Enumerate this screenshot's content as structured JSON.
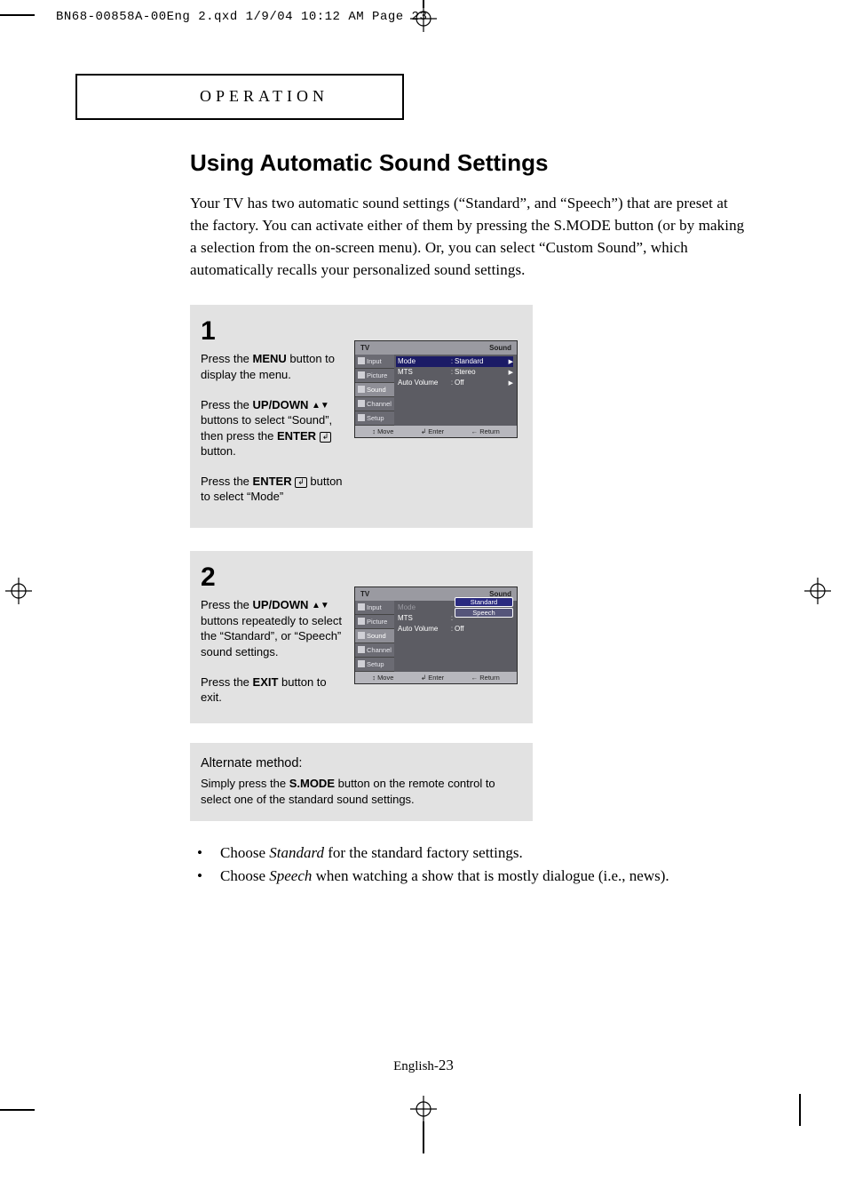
{
  "slug": "BN68-00858A-00Eng 2.qxd  1/9/04 10:12 AM  Page 23",
  "section_header": "OPERATION",
  "title": "Using Automatic Sound Settings",
  "intro": "Your TV has two automatic sound settings (“Standard”, and “Speech”) that are preset at the factory. You can activate either of them by pressing the S.MODE button (or by making a selection from the on-screen menu). Or, you can select “Custom Sound”, which automatically recalls your personalized sound settings.",
  "step1": {
    "num": "1",
    "p1a": "Press the ",
    "p1b": "MENU",
    "p1c": " button to display the menu.",
    "p2a": "Press the ",
    "p2b": "UP/DOWN",
    "p2c": " buttons to select “Sound”, then press the ",
    "p2d": "ENTER",
    "p2e": " button.",
    "p3a": "Press the ",
    "p3b": "ENTER",
    "p3c": " button to select “Mode”",
    "tri_up": "▲",
    "tri_down": "▼",
    "enter_glyph": "↲"
  },
  "step2": {
    "num": "2",
    "p1a": "Press the ",
    "p1b": "UP/DOWN",
    "p1c": " buttons repeatedly to select the “Standard”, or “Speech” sound settings.",
    "p2a": "Press the ",
    "p2b": "EXIT",
    "p2c": " button to exit.",
    "tri_up": "▲",
    "tri_down": "▼"
  },
  "alt": {
    "head": "Alternate method:",
    "body_a": "Simply press the ",
    "body_b": "S.MODE",
    "body_c": " button on the remote control to select one of the standard sound settings."
  },
  "bullets": [
    {
      "pre": "Choose ",
      "em": "Standard",
      "post": " for the standard factory settings."
    },
    {
      "pre": "Choose ",
      "em": "Speech",
      "post": " when watching a show that is mostly dialogue (i.e., news)."
    }
  ],
  "osd_labels": {
    "tv": "TV",
    "sound": "Sound",
    "tabs": [
      "Input",
      "Picture",
      "Sound",
      "Channel",
      "Setup"
    ],
    "mode": "Mode",
    "mts": "MTS",
    "auto_volume": "Auto Volume",
    "standard": "Standard",
    "stereo": "Stereo",
    "off": "Off",
    "speech": "Speech",
    "move": "Move",
    "enter": "Enter",
    "return": "Return",
    "colon": ":",
    "rarrow": "▶",
    "udarrow": "↕",
    "enter_sym": "↲",
    "return_sym": "←"
  },
  "footer": {
    "prefix": "English-",
    "num": "23"
  }
}
